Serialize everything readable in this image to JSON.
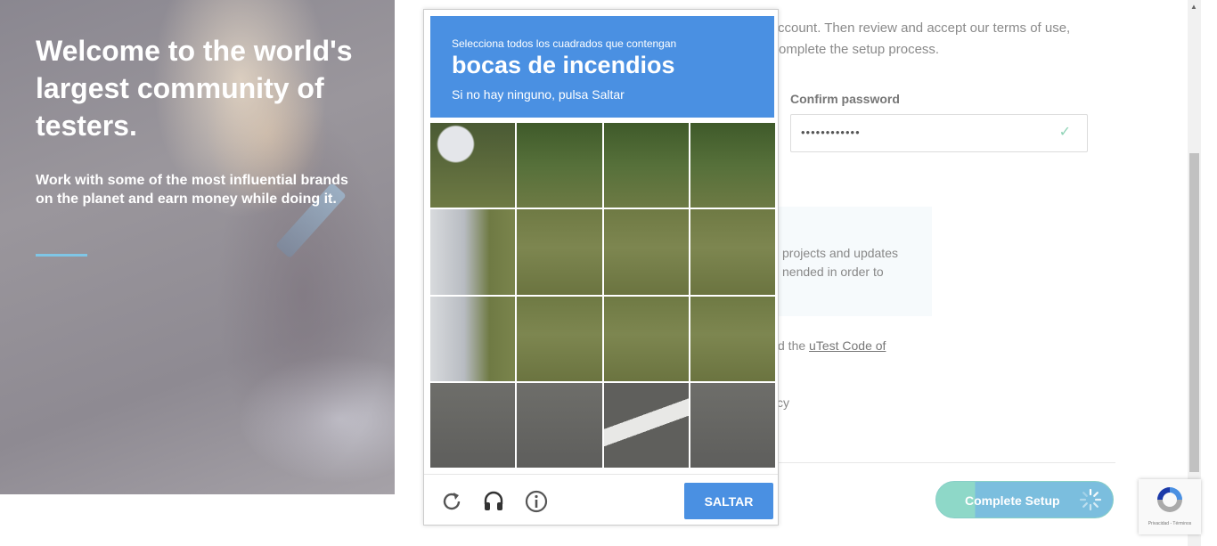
{
  "hero": {
    "title": "Welcome to the world's largest community of testers.",
    "subtitle": "Work with some of the most influential brands on the planet and earn money while doing it."
  },
  "form": {
    "intro_line1": "ccount. Then review and accept our terms of use,",
    "intro_line2": "omplete the setup process.",
    "confirm_password_label": "Confirm password",
    "confirm_password_value": "••••••••••••",
    "info_text": "projects and updates nended in order to",
    "agree_prefix": "d the ",
    "agree_link": "uTest Code of",
    "policy_text": "cy",
    "complete_button": "Complete Setup"
  },
  "captcha": {
    "instruction": "Selecciona todos los cuadrados que contengan",
    "target": "bocas de incendios",
    "hint": "Si no hay ninguno, pulsa Saltar",
    "skip_button": "SALTAR",
    "tiles": [
      "car-mirror",
      "grass-dark",
      "grass-dark",
      "grass-dark",
      "car",
      "grass",
      "grass",
      "grass",
      "car",
      "grass",
      "grass",
      "grass",
      "road",
      "road",
      "road-line",
      "road"
    ],
    "icons": [
      "reload-icon",
      "audio-icon",
      "info-icon"
    ]
  },
  "badge": {
    "text": "Privacidad - Términos"
  },
  "colors": {
    "accent": "#4a90e2",
    "hero_line": "#7fc6e6",
    "button_left": "#8ed8c8",
    "button_right": "#7bbede"
  }
}
